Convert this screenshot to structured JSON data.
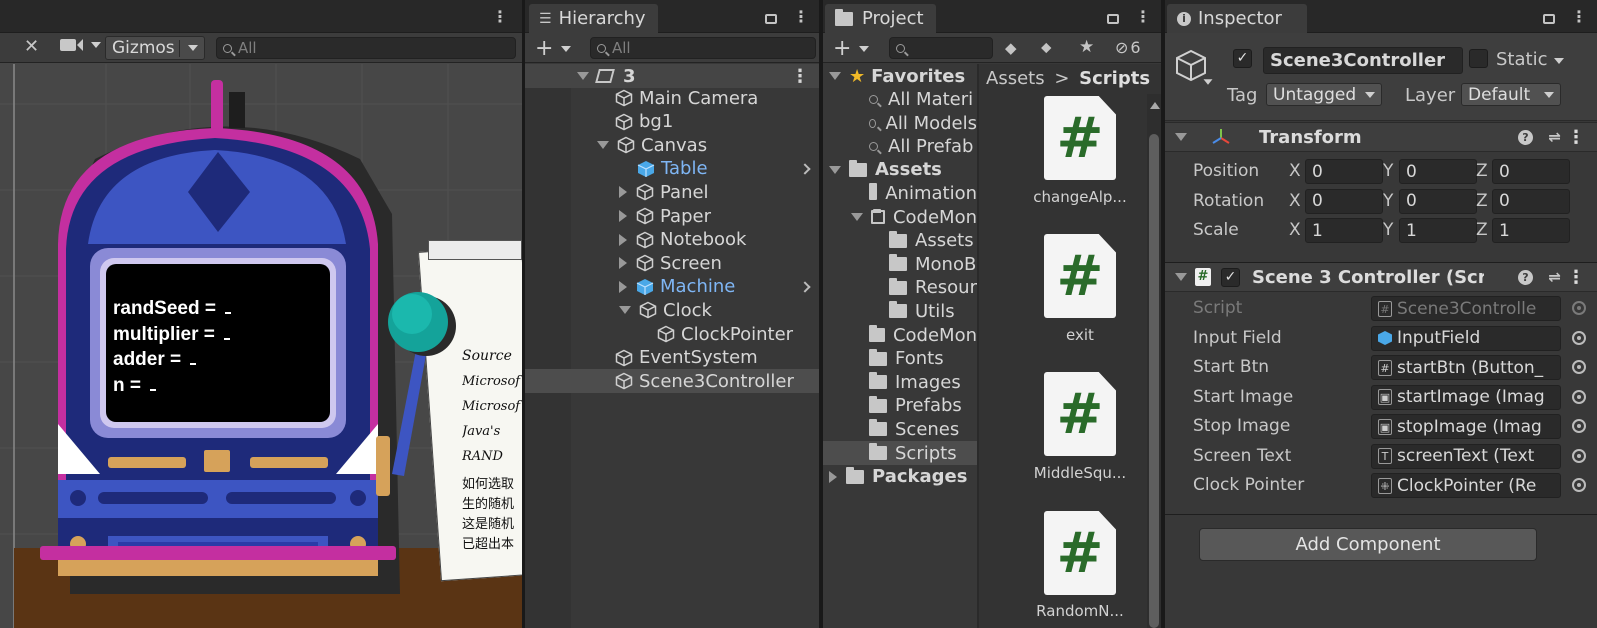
{
  "scene_view": {
    "gizmos_label": "Gizmos",
    "search_placeholder": "All",
    "screen_lines": [
      "randSeed = ",
      "multiplier = ",
      "adder = ",
      "n = "
    ],
    "paper_lines": [
      "Source",
      "Microsof",
      "Microsof",
      "Java's",
      "RAND",
      "如何选取",
      "生的随机",
      "这是随机",
      "已超出本"
    ]
  },
  "hierarchy": {
    "tab_label": "Hierarchy",
    "search_placeholder": "All",
    "scene_name": "3",
    "items": [
      {
        "label": "Main Camera"
      },
      {
        "label": "bg1"
      },
      {
        "label": "Canvas"
      },
      {
        "label": "Table"
      },
      {
        "label": "Panel"
      },
      {
        "label": "Paper"
      },
      {
        "label": "Notebook"
      },
      {
        "label": "Screen"
      },
      {
        "label": "Machine"
      },
      {
        "label": "Clock"
      },
      {
        "label": "ClockPointer"
      },
      {
        "label": "EventSystem"
      },
      {
        "label": "Scene3Controller"
      }
    ]
  },
  "project": {
    "tab_label": "Project",
    "hidden_count": "6",
    "tree": [
      {
        "label": "Favorites"
      },
      {
        "label": "All Materi"
      },
      {
        "label": "All Models"
      },
      {
        "label": "All Prefab"
      },
      {
        "label": "Assets"
      },
      {
        "label": "Animation"
      },
      {
        "label": "CodeMon"
      },
      {
        "label": "Assets"
      },
      {
        "label": "MonoB"
      },
      {
        "label": "Resour"
      },
      {
        "label": "Utils"
      },
      {
        "label": "CodeMon"
      },
      {
        "label": "Fonts"
      },
      {
        "label": "Images"
      },
      {
        "label": "Prefabs"
      },
      {
        "label": "Scenes"
      },
      {
        "label": "Scripts"
      },
      {
        "label": "Packages"
      }
    ],
    "breadcrumb": {
      "root": "Assets",
      "separator": ">",
      "current": "Scripts"
    },
    "files": [
      {
        "label": "changeAlp..."
      },
      {
        "label": "exit"
      },
      {
        "label": "MiddleSqu..."
      },
      {
        "label": "RandomN..."
      }
    ],
    "script_glyph": "#"
  },
  "inspector": {
    "tab_label": "Inspector",
    "object_name": "Scene3Controller",
    "static_label": "Static",
    "tag_label": "Tag",
    "tag_value": "Untagged",
    "layer_label": "Layer",
    "layer_value": "Default",
    "transform": {
      "title": "Transform",
      "rows": [
        {
          "label": "Position",
          "x": "0",
          "y": "0",
          "z": "0"
        },
        {
          "label": "Rotation",
          "x": "0",
          "y": "0",
          "z": "0"
        },
        {
          "label": "Scale",
          "x": "1",
          "y": "1",
          "z": "1"
        }
      ],
      "axis_x": "X",
      "axis_y": "Y",
      "axis_z": "Z"
    },
    "component": {
      "title": "Scene 3 Controller (Scri",
      "fields": [
        {
          "label": "Script",
          "value": "Scene3Controlle"
        },
        {
          "label": "Input Field",
          "value": "InputField"
        },
        {
          "label": "Start Btn",
          "value": "startBtn (Button_"
        },
        {
          "label": "Start Image",
          "value": "startImage (Imag"
        },
        {
          "label": "Stop Image",
          "value": "stopImage (Imag"
        },
        {
          "label": "Screen Text",
          "value": "screenText (Text"
        },
        {
          "label": "Clock Pointer",
          "value": "ClockPointer (Re"
        }
      ]
    },
    "add_component_label": "Add Component"
  },
  "colors": {
    "panel_bg": "#383838",
    "selection": "#4d4d4d",
    "prefab_blue": "#7fb6f5",
    "scene_bg": "#474747",
    "machine_blue": "#26348a",
    "machine_magenta": "#c42fa0",
    "knob_teal": "#14a39a"
  }
}
